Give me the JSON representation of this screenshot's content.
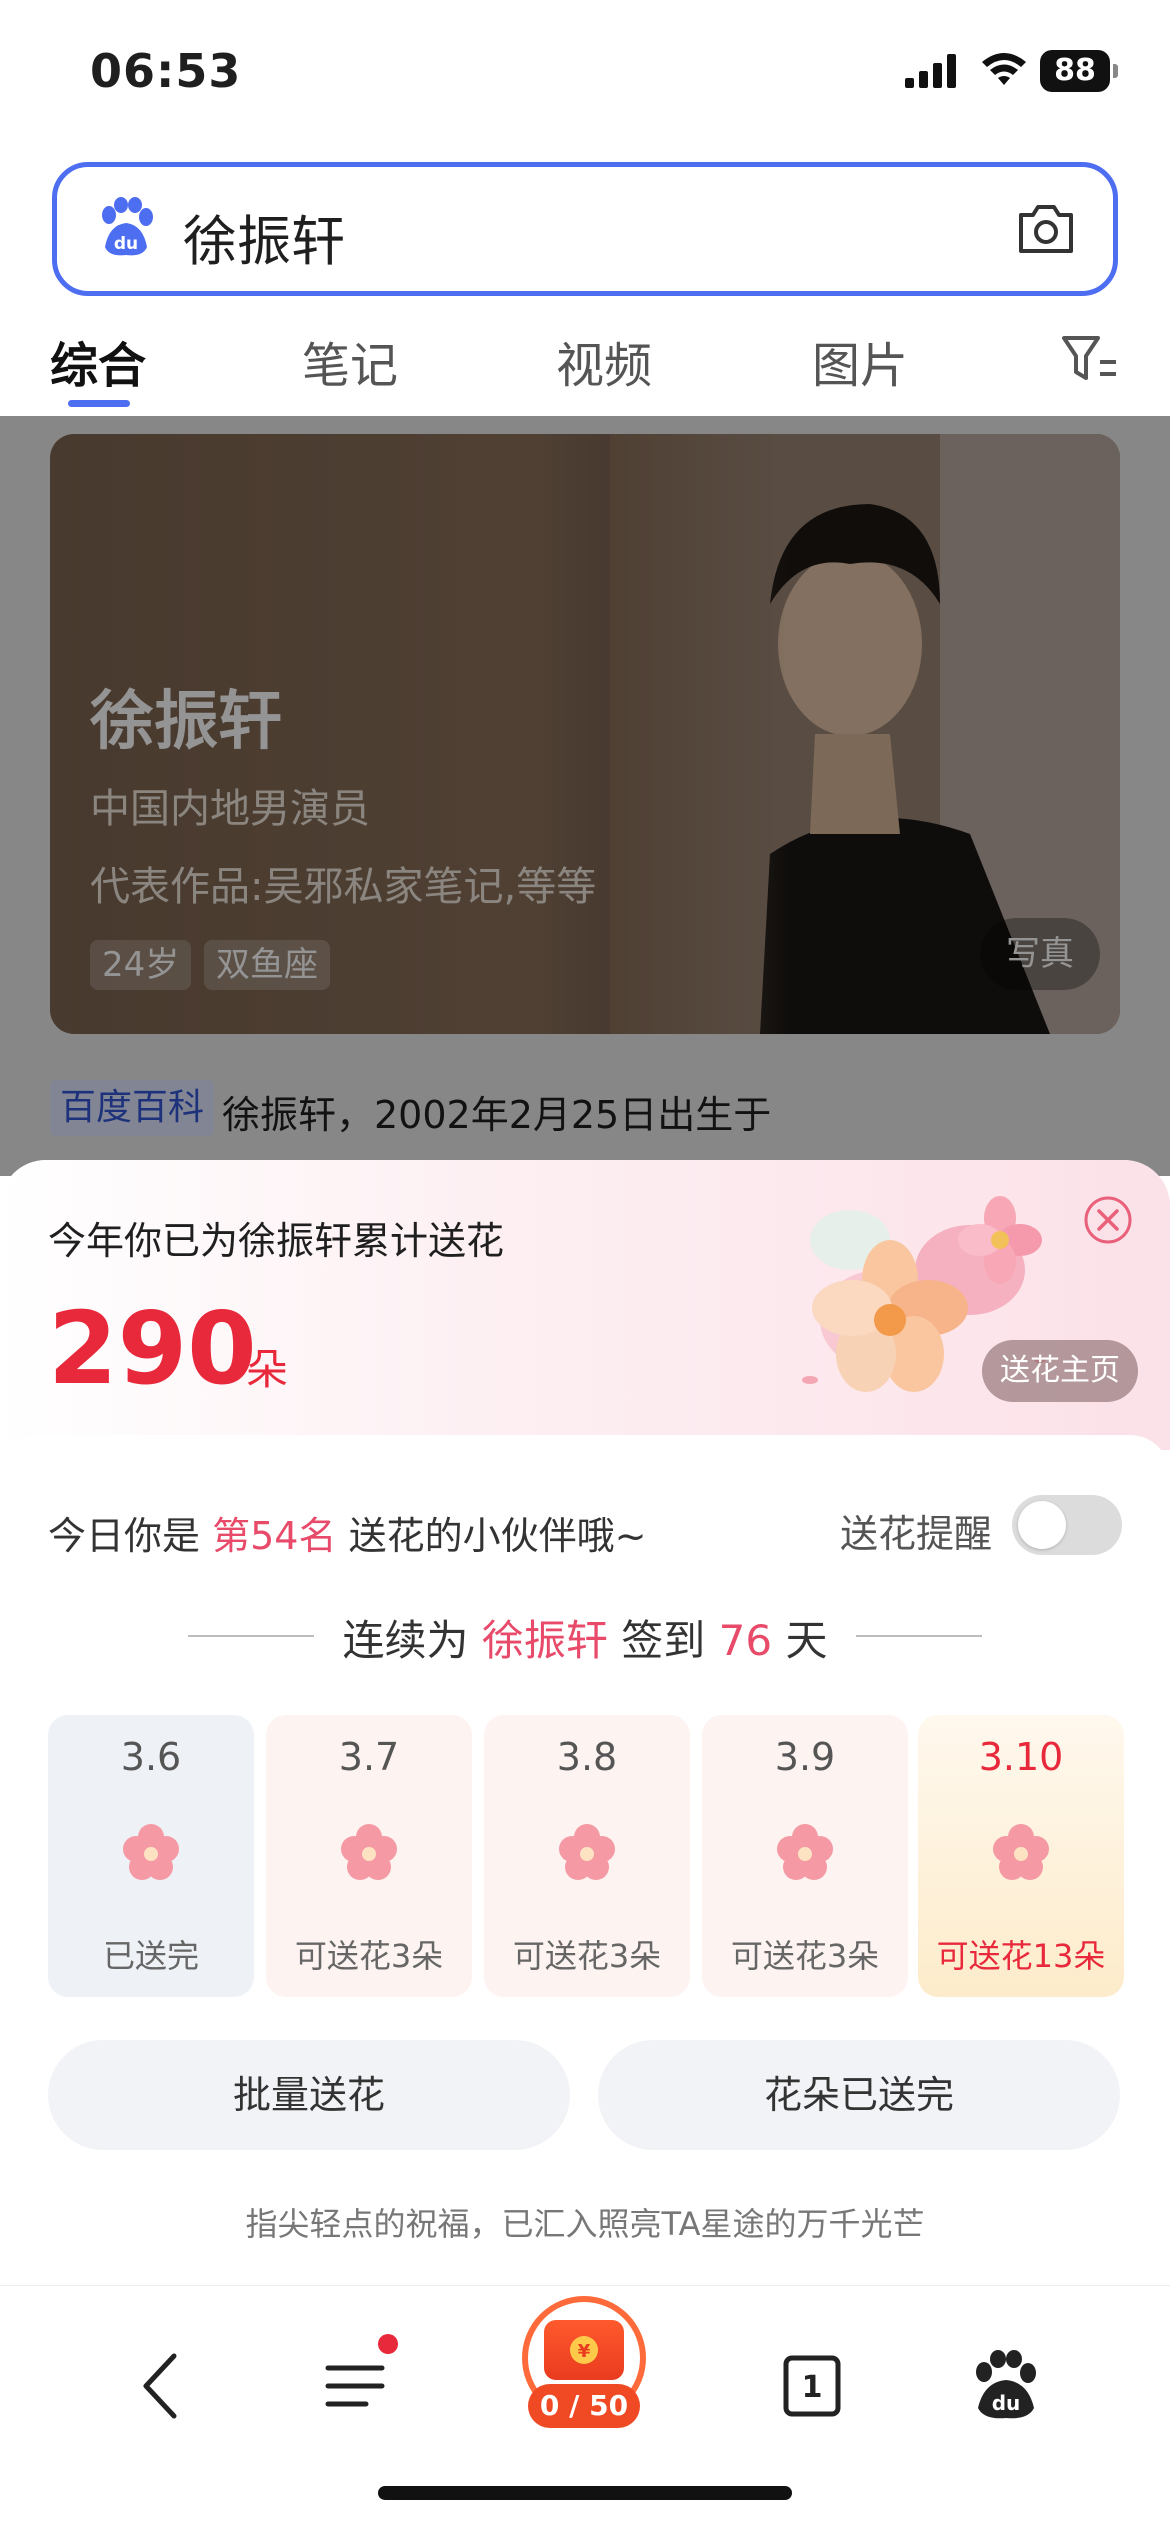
{
  "status_bar": {
    "time": "06:53",
    "battery": "88"
  },
  "search": {
    "query": "徐振轩"
  },
  "tabs": [
    {
      "label": "综合",
      "active": true
    },
    {
      "label": "笔记"
    },
    {
      "label": "视频"
    },
    {
      "label": "图片"
    }
  ],
  "hero": {
    "name": "徐振轩",
    "subtitle": "中国内地男演员",
    "works": "代表作品:吴邪私家笔记,等等",
    "tags": [
      "24岁",
      "双鱼座"
    ],
    "photo_button": "写真"
  },
  "baike": {
    "badge": "百度百科",
    "text": "徐振轩，2002年2月25日出生于"
  },
  "sheet": {
    "title": "今年你已为徐振轩累计送花",
    "count": "290",
    "unit": "朵",
    "homepage_button": "送花主页",
    "rank_prefix": "今日你是",
    "rank": "第54名",
    "rank_suffix": "送花的小伙伴哦~",
    "reminder_label": "送花提醒",
    "reminder_on": false,
    "streak_prefix": "连续为",
    "streak_name": "徐振轩",
    "streak_mid": "签到",
    "streak_days": "76",
    "streak_suffix": "天",
    "days": [
      {
        "date": "3.6",
        "label": "已送完"
      },
      {
        "date": "3.7",
        "label": "可送花3朵"
      },
      {
        "date": "3.8",
        "label": "可送花3朵"
      },
      {
        "date": "3.9",
        "label": "可送花3朵"
      },
      {
        "date": "3.10",
        "label": "可送花13朵",
        "highlight": true
      }
    ],
    "batch_button": "批量送花",
    "done_button": "花朵已送完",
    "footer": "指尖轻点的祝福，已汇入照亮TA星途的万千光芒"
  },
  "nav": {
    "reward_count": "0 / 50",
    "tab_count": "1"
  },
  "colors": {
    "accent": "#4e6ef2",
    "red": "#e8293b",
    "pink": "#e84a6a"
  }
}
